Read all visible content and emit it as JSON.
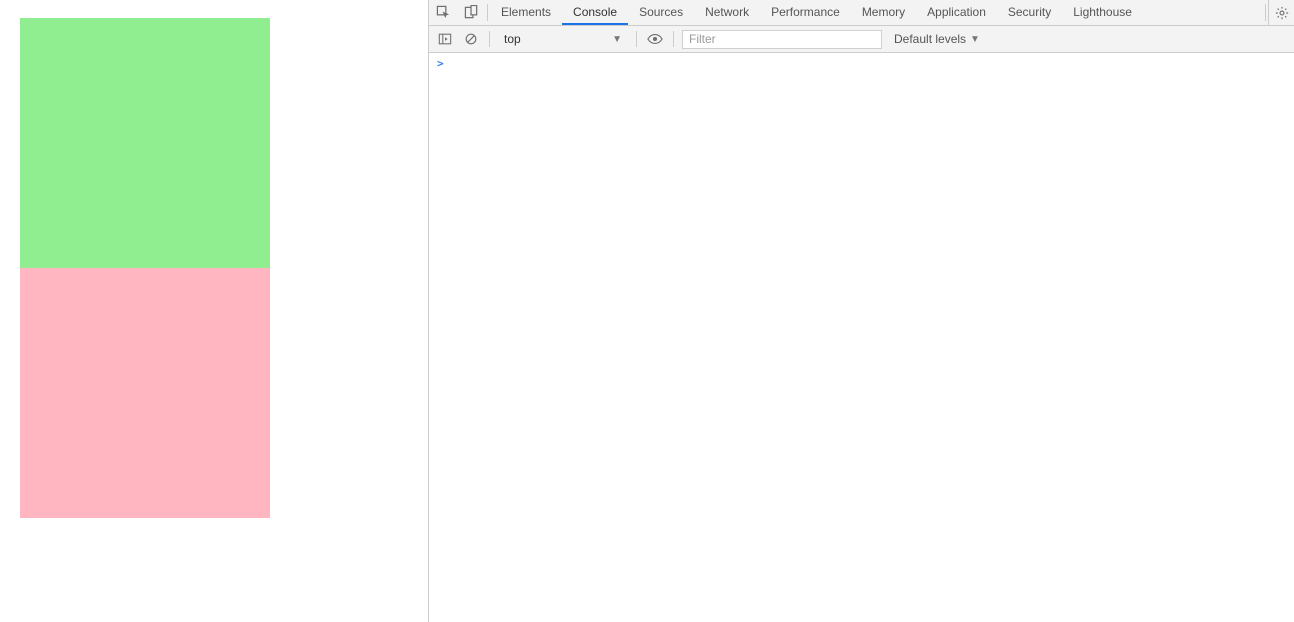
{
  "page": {
    "blocks": [
      {
        "color": "#90ee90"
      },
      {
        "color": "#ffb6c1"
      }
    ]
  },
  "devtools": {
    "tabs": [
      "Elements",
      "Console",
      "Sources",
      "Network",
      "Performance",
      "Memory",
      "Application",
      "Security",
      "Lighthouse"
    ],
    "active_tab": "Console",
    "toolbar": {
      "context": "top",
      "filter_placeholder": "Filter",
      "levels_label": "Default levels"
    },
    "prompt": ">"
  }
}
